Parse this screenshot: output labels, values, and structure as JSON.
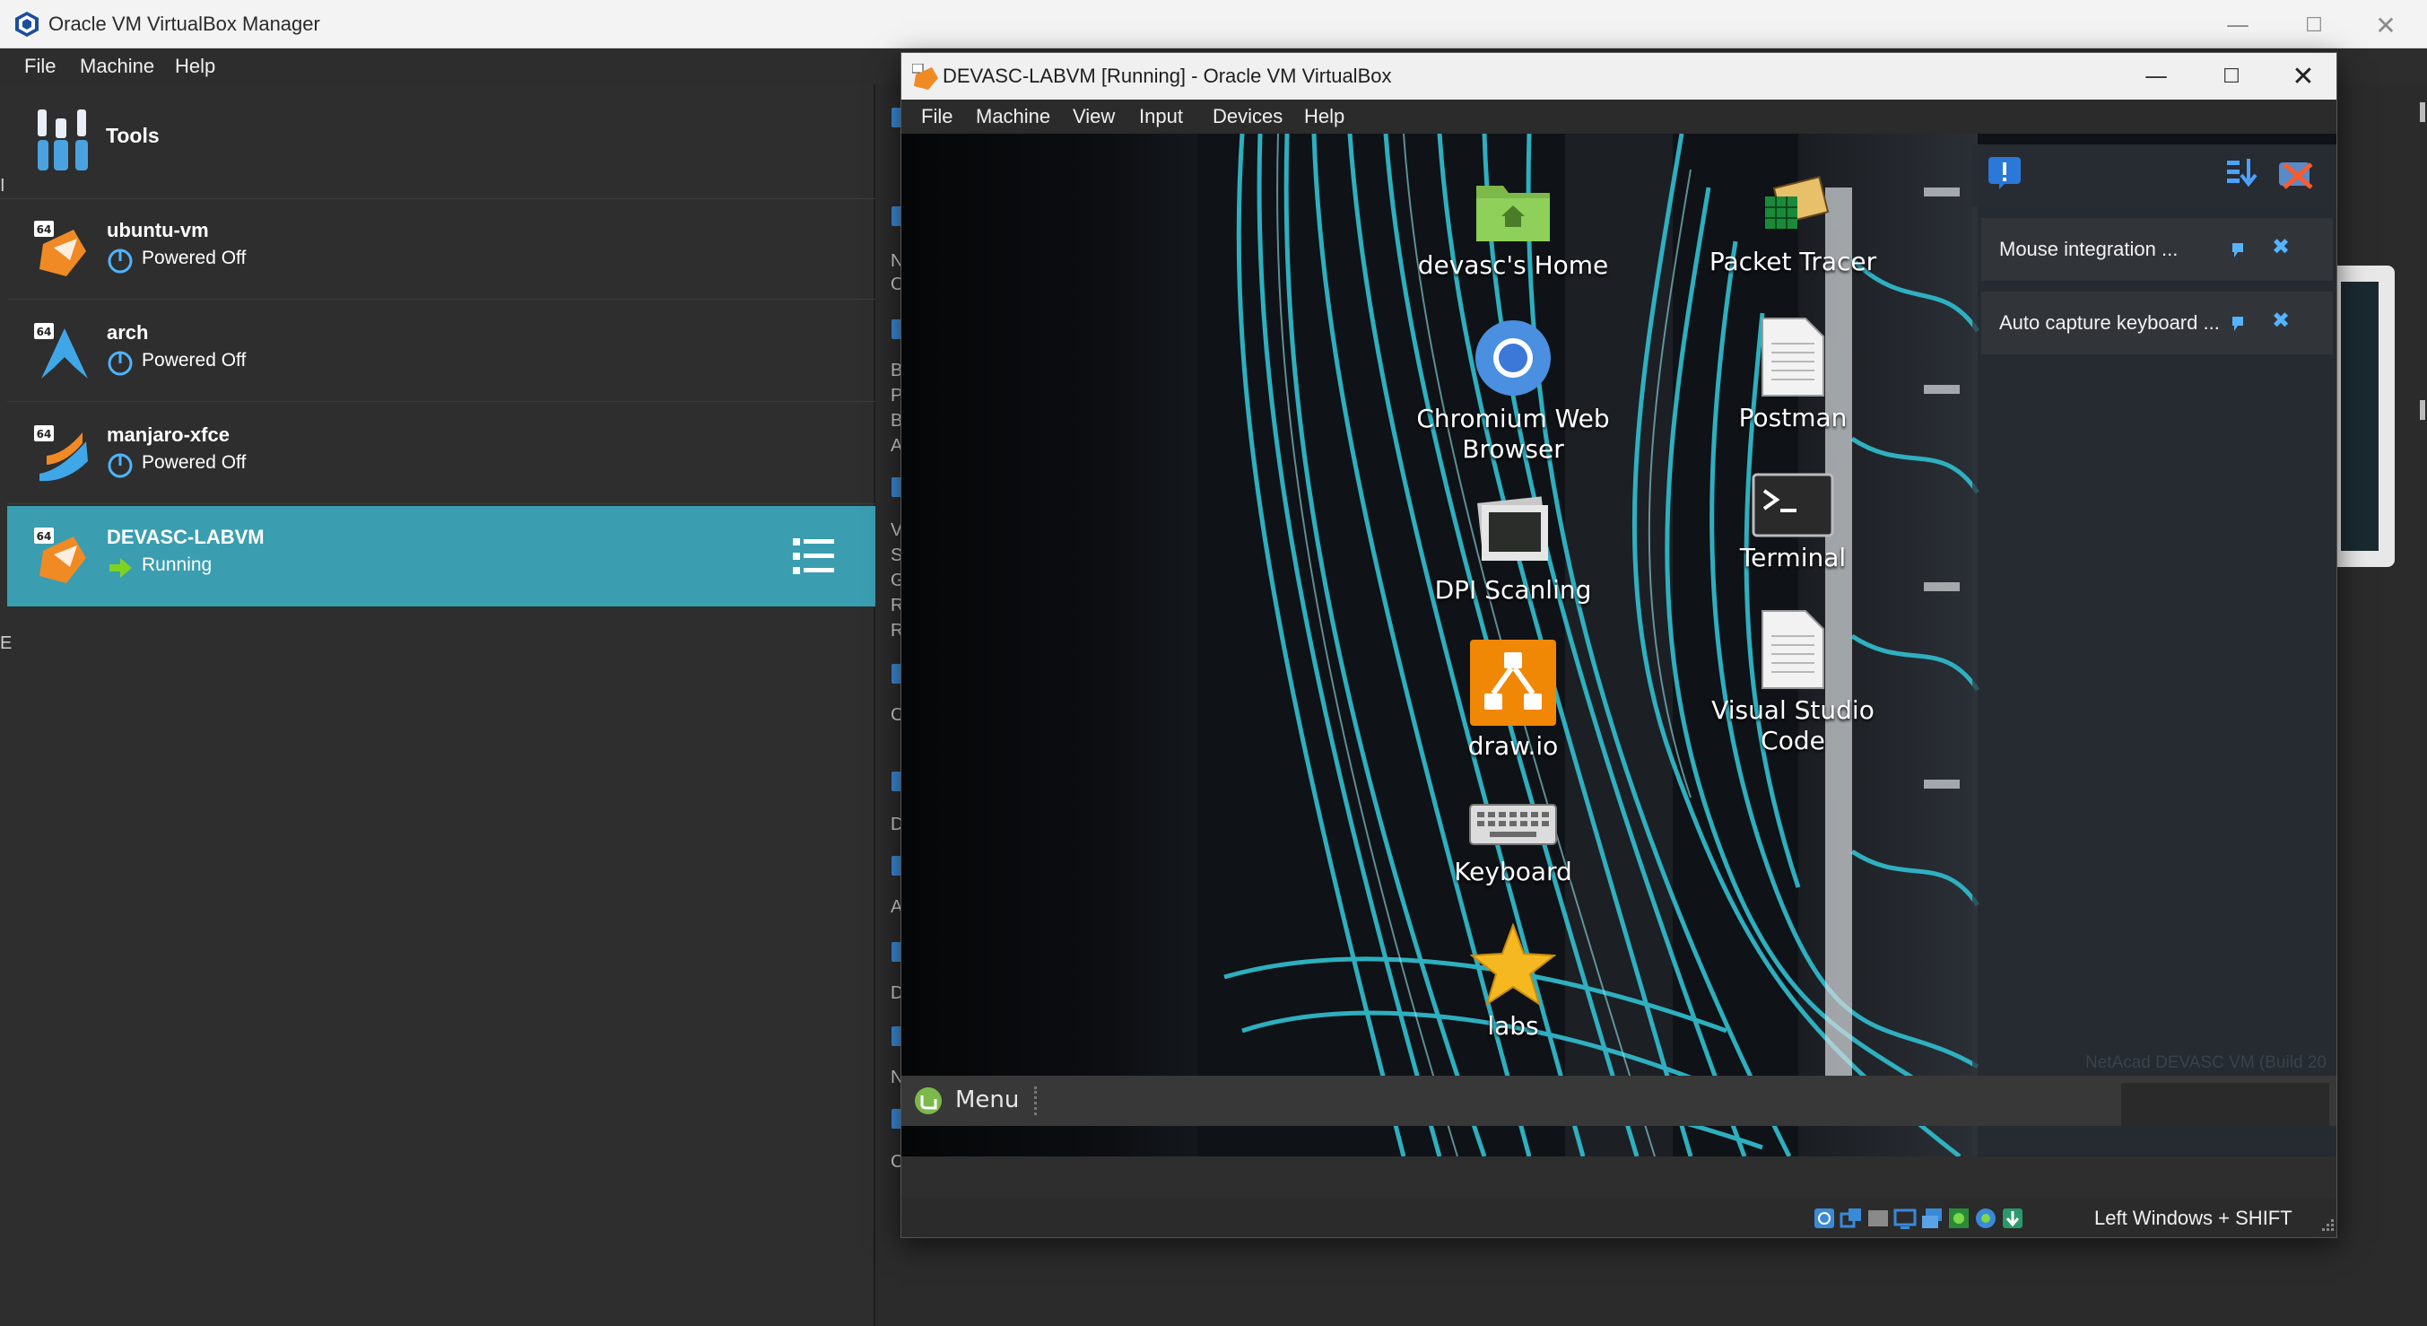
{
  "manager": {
    "window_title": "Oracle VM VirtualBox Manager",
    "window_controls": {
      "minimize": "—",
      "maximize": "☐",
      "close": "✕"
    },
    "menu": [
      "File",
      "Machine",
      "Help"
    ],
    "tools_label": "Tools",
    "vms": [
      {
        "name": "ubuntu-vm",
        "state": "Powered Off",
        "badge": "64",
        "icon": "ubuntu-os-icon",
        "selected": false
      },
      {
        "name": "arch",
        "state": "Powered Off",
        "badge": "64",
        "icon": "arch-os-icon",
        "selected": false
      },
      {
        "name": "manjaro-xfce",
        "state": "Powered Off",
        "badge": "64",
        "icon": "manjaro-os-icon",
        "selected": false
      },
      {
        "name": "DEVASC-LABVM",
        "state": "Running",
        "badge": "64",
        "icon": "ubuntu-os-icon",
        "selected": true
      }
    ],
    "details_clipped_letters": [
      "N",
      "O",
      "B",
      "P",
      "B",
      "A",
      "V",
      "S",
      "G",
      "R",
      "R",
      "C",
      "D",
      "A",
      "D",
      "N",
      "C"
    ],
    "left_edge_letters": [
      "I",
      "E"
    ],
    "selection_color": "#3a9db0"
  },
  "vm_window": {
    "title": "DEVASC-LABVM [Running] - Oracle VM VirtualBox",
    "window_controls": {
      "minimize": "—",
      "maximize": "☐",
      "close": "✕"
    },
    "menu": [
      "File",
      "Machine",
      "View",
      "Input",
      "Devices",
      "Help"
    ],
    "desktop_icons_col1": [
      {
        "label": "devasc's Home",
        "icon": "home-folder-icon"
      },
      {
        "label_line1": "Chromium Web",
        "label_line2": "Browser",
        "icon": "chromium-icon"
      },
      {
        "label": "DPI Scanling",
        "icon": "monitor-icon"
      },
      {
        "label": "draw.io",
        "icon": "drawio-icon"
      },
      {
        "label": "Keyboard",
        "icon": "keyboard-icon"
      },
      {
        "label": "labs",
        "icon": "star-icon"
      }
    ],
    "desktop_icons_col2": [
      {
        "label": "Packet Tracer",
        "icon": "packet-tracer-icon"
      },
      {
        "label": "Postman",
        "icon": "document-icon"
      },
      {
        "label": "Terminal",
        "icon": "terminal-icon"
      },
      {
        "label": "Visual Studio Code",
        "icon": "document-icon"
      }
    ],
    "notifications": [
      {
        "text": "Mouse integration ...",
        "close": "✖"
      },
      {
        "text": "Auto capture keyboard ...",
        "close": "✖"
      }
    ],
    "netacad_text": "NetAcad DEVASC VM (Build 20",
    "panel_menu_label": "Menu",
    "host_key": "Left Windows + SHIFT",
    "accent_cyan": "#2fb8c9"
  }
}
